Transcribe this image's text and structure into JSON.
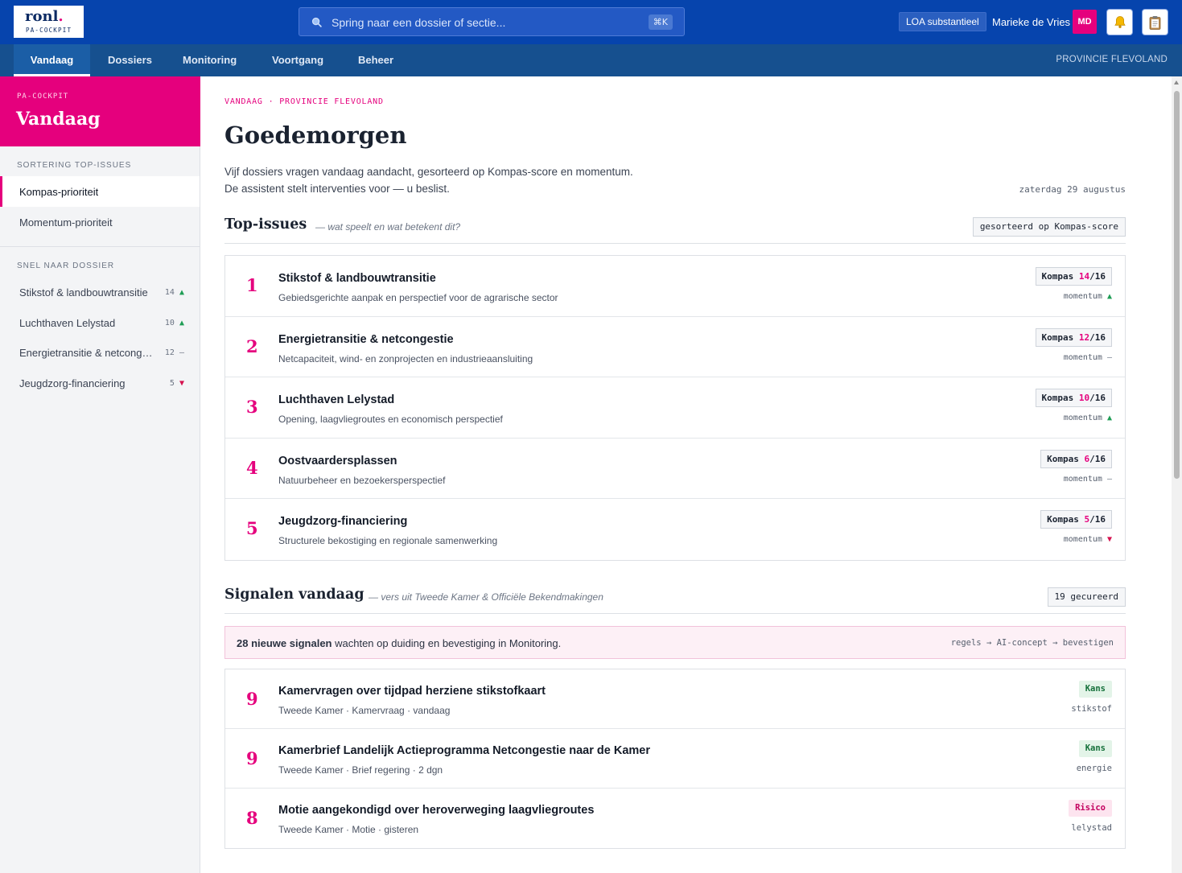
{
  "app": {
    "logo_word": "ronl",
    "logo_dot": ".",
    "logo_sub": "PA-COCKPIT",
    "search_placeholder": "Spring naar een dossier of sectie...",
    "search_shortcut": "⌘K",
    "loa_label": "LOA substantieel",
    "user_name": "Marieke de Vries",
    "user_initials": "MD",
    "bell_icon": "bell-icon",
    "notes_icon": "clipboard-icon"
  },
  "nav": {
    "tabs": [
      {
        "label": "Vandaag",
        "active": true
      },
      {
        "label": "Dossiers",
        "active": false
      },
      {
        "label": "Monitoring",
        "active": false
      },
      {
        "label": "Voortgang",
        "active": false
      },
      {
        "label": "Beheer",
        "active": false
      }
    ],
    "province": "PROVINCIE FLEVOLAND"
  },
  "sidebar": {
    "kicker": "PA-COCKPIT",
    "title": "Vandaag",
    "sort_section": "SORTERING TOP-ISSUES",
    "sort_options": [
      {
        "label": "Kompas-prioriteit",
        "active": true
      },
      {
        "label": "Momentum-prioriteit",
        "active": false
      }
    ],
    "quick_section": "SNEL NAAR DOSSIER",
    "quick_items": [
      {
        "label": "Stikstof & landbouwtransitie",
        "count": "14",
        "trend": "▲",
        "trend_class": "up"
      },
      {
        "label": "Luchthaven Lelystad",
        "count": "10",
        "trend": "▲",
        "trend_class": "up"
      },
      {
        "label": "Energietransitie & netcongestie",
        "count": "12",
        "trend": "–",
        "trend_class": "flat"
      },
      {
        "label": "Jeugdzorg-financiering",
        "count": "5",
        "trend": "▼",
        "trend_class": "down"
      }
    ]
  },
  "main": {
    "breadcrumb": "VANDAAG · PROVINCIE FLEVOLAND",
    "greeting": "Goedemorgen",
    "intro_line1": "Vijf dossiers vragen vandaag aandacht, gesorteerd op Kompas-score en momentum.",
    "intro_line2": "De assistent stelt interventies voor — u beslist.",
    "date": "zaterdag 29 augustus",
    "top_issues": {
      "title": "Top-issues",
      "subtitle": "— wat speelt en wat betekent dit?",
      "sort_chip": "gesorteerd op Kompas-score",
      "kompas_label": "Kompas",
      "momentum_label": "momentum",
      "items": [
        {
          "rank": "1",
          "title": "Stikstof & landbouwtransitie",
          "desc": "Gebiedsgerichte aanpak en perspectief voor de agrarische sector",
          "score": "14",
          "max": "/16",
          "trend": "▲",
          "trend_class": "up"
        },
        {
          "rank": "2",
          "title": "Energietransitie & netcongestie",
          "desc": "Netcapaciteit, wind- en zonprojecten en industrieaansluiting",
          "score": "12",
          "max": "/16",
          "trend": "–",
          "trend_class": "flat"
        },
        {
          "rank": "3",
          "title": "Luchthaven Lelystad",
          "desc": "Opening, laagvliegroutes en economisch perspectief",
          "score": "10",
          "max": "/16",
          "trend": "▲",
          "trend_class": "up"
        },
        {
          "rank": "4",
          "title": "Oostvaardersplassen",
          "desc": "Natuurbeheer en bezoekersperspectief",
          "score": "6",
          "max": "/16",
          "trend": "–",
          "trend_class": "flat"
        },
        {
          "rank": "5",
          "title": "Jeugdzorg-financiering",
          "desc": "Structurele bekostiging en regionale samenwerking",
          "score": "5",
          "max": "/16",
          "trend": "▼",
          "trend_class": "down"
        }
      ]
    },
    "signals": {
      "title": "Signalen vandaag",
      "subtitle": "— vers uit Tweede Kamer & Officiële Bekendmakingen",
      "curated_chip": "19 gecureerd",
      "notice_bold": "28 nieuwe signalen",
      "notice_rest": " wachten op duiding en bevestiging in Monitoring.",
      "notice_flow": "regels → AI-concept → bevestigen",
      "items": [
        {
          "score": "9",
          "title": "Kamervragen over tijdpad herziene stikstofkaart",
          "meta": "Tweede Kamer · Kamervraag · vandaag",
          "tag": "Kans",
          "tag_class": "kans",
          "topic": "stikstof"
        },
        {
          "score": "9",
          "title": "Kamerbrief Landelijk Actieprogramma Netcongestie naar de Kamer",
          "meta": "Tweede Kamer · Brief regering · 2 dgn",
          "tag": "Kans",
          "tag_class": "kans",
          "topic": "energie"
        },
        {
          "score": "8",
          "title": "Motie aangekondigd over heroverweging laagvliegroutes",
          "meta": "Tweede Kamer · Motie · gisteren",
          "tag": "Risico",
          "tag_class": "risico",
          "topic": "lelystad"
        }
      ]
    }
  },
  "colors": {
    "brand_blue": "#0644ad",
    "nav_blue": "#16508f",
    "accent_pink": "#e5007d",
    "up_green": "#1f9d55",
    "down_red": "#d5114e"
  }
}
